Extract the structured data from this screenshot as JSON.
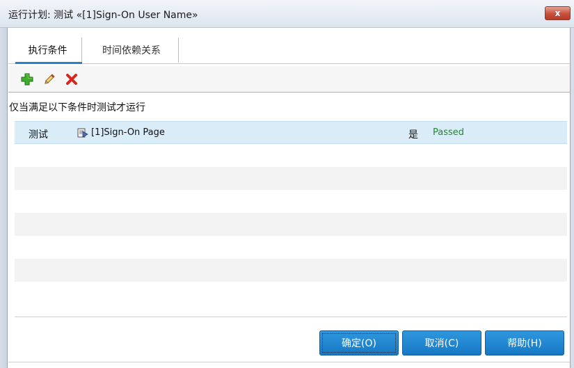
{
  "window": {
    "title": "运行计划: 测试 «[1]Sign-On User Name»",
    "close_label": "x"
  },
  "tabs": [
    {
      "label": "执行条件",
      "active": true
    },
    {
      "label": "时间依赖关系",
      "active": false
    }
  ],
  "toolbar": {
    "add_icon": "add-icon",
    "edit_icon": "pencil-icon",
    "delete_icon": "delete-icon"
  },
  "section": {
    "heading": "仅当满足以下条件时测试才运行"
  },
  "conditions": [
    {
      "type": "测试",
      "icon": "test-run-icon",
      "name": "[1]Sign-On Page",
      "required": "是",
      "status": "Passed"
    }
  ],
  "buttons": {
    "ok": "确定(O)",
    "cancel": "取消(C)",
    "help": "帮助(H)"
  },
  "colors": {
    "accent": "#1a7ec8",
    "status_passed": "#1f8a2e",
    "selected_row": "#d9ecf7",
    "close_button": "#c7503b"
  }
}
